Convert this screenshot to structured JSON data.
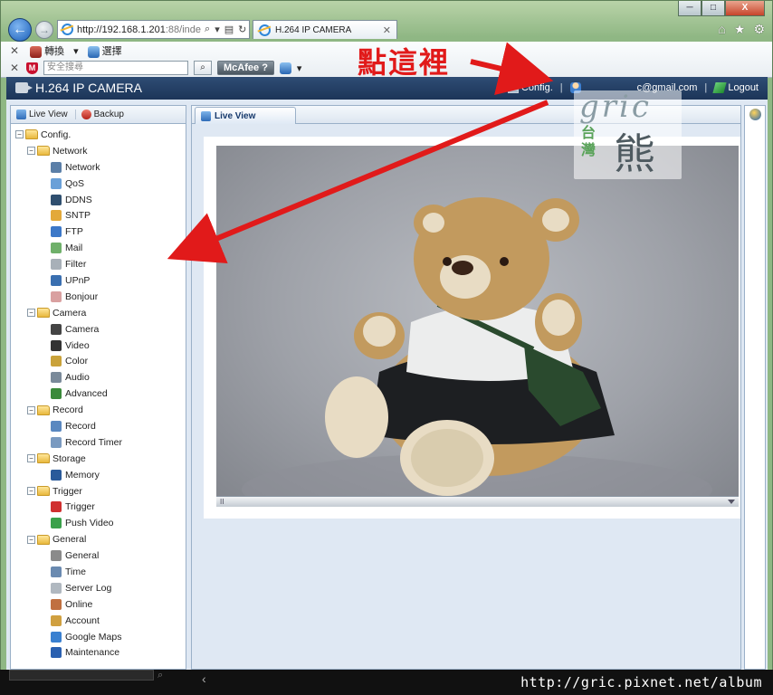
{
  "browser": {
    "window_buttons": [
      "─",
      "□",
      "X"
    ],
    "address": "http://192.168.1.201",
    "address_suffix": ":88/inde",
    "tab_title": "H.264 IP CAMERA",
    "toolbar_row1": [
      "轉換",
      "選擇"
    ],
    "search_placeholder": "安全搜尋",
    "mcafee_label": "McAfee"
  },
  "annotation": {
    "click_here": "點這裡",
    "arrow_color": "#e11a1a"
  },
  "app": {
    "title": "H.264 IP CAMERA",
    "header": {
      "config_label": "Config.",
      "email": "@gmail.com",
      "email_prefix": "c",
      "logout_label": "Logout"
    },
    "left_tabs": [
      "Live View",
      "Backup"
    ],
    "tree": [
      {
        "label": "Config.",
        "level": 0,
        "folder": true
      },
      {
        "label": "Network",
        "level": 1,
        "folder": true
      },
      {
        "label": "Network",
        "level": 2,
        "icon": "network-icon",
        "color": "#5b7fa8"
      },
      {
        "label": "QoS",
        "level": 2,
        "icon": "qos-icon",
        "color": "#6aa0d8"
      },
      {
        "label": "DDNS",
        "level": 2,
        "icon": "ddns-icon",
        "color": "#2f4f6f"
      },
      {
        "label": "SNTP",
        "level": 2,
        "icon": "sntp-icon",
        "color": "#e3a93a"
      },
      {
        "label": "FTP",
        "level": 2,
        "icon": "ftp-icon",
        "color": "#3c78c8"
      },
      {
        "label": "Mail",
        "level": 2,
        "icon": "mail-icon",
        "color": "#6fb06a"
      },
      {
        "label": "Filter",
        "level": 2,
        "icon": "filter-icon",
        "color": "#a8b0b8"
      },
      {
        "label": "UPnP",
        "level": 2,
        "icon": "upnp-icon",
        "color": "#3a6fb0"
      },
      {
        "label": "Bonjour",
        "level": 2,
        "icon": "bonjour-icon",
        "color": "#d9a0a0"
      },
      {
        "label": "Camera",
        "level": 1,
        "folder": true
      },
      {
        "label": "Camera",
        "level": 2,
        "icon": "camera-icon",
        "color": "#444444"
      },
      {
        "label": "Video",
        "level": 2,
        "icon": "video-icon",
        "color": "#333333"
      },
      {
        "label": "Color",
        "level": 2,
        "icon": "color-icon",
        "color": "#c9a23a"
      },
      {
        "label": "Audio",
        "level": 2,
        "icon": "audio-icon",
        "color": "#7a8a9a"
      },
      {
        "label": "Advanced",
        "level": 2,
        "icon": "advanced-icon",
        "color": "#3a8a3a"
      },
      {
        "label": "Record",
        "level": 1,
        "folder": true
      },
      {
        "label": "Record",
        "level": 2,
        "icon": "record-icon",
        "color": "#5a88c0"
      },
      {
        "label": "Record Timer",
        "level": 2,
        "icon": "record-timer-icon",
        "color": "#7a9ac0"
      },
      {
        "label": "Storage",
        "level": 1,
        "folder": true
      },
      {
        "label": "Memory",
        "level": 2,
        "icon": "memory-icon",
        "color": "#2a5a9a"
      },
      {
        "label": "Trigger",
        "level": 1,
        "folder": true
      },
      {
        "label": "Trigger",
        "level": 2,
        "icon": "trigger-icon",
        "color": "#d03030"
      },
      {
        "label": "Push Video",
        "level": 2,
        "icon": "push-video-icon",
        "color": "#3aa04a"
      },
      {
        "label": "General",
        "level": 1,
        "folder": true
      },
      {
        "label": "General",
        "level": 2,
        "icon": "general-icon",
        "color": "#8a8a8a"
      },
      {
        "label": "Time",
        "level": 2,
        "icon": "time-icon",
        "color": "#6a8ab0"
      },
      {
        "label": "Server Log",
        "level": 2,
        "icon": "server-log-icon",
        "color": "#b0b8c0"
      },
      {
        "label": "Online",
        "level": 2,
        "icon": "online-icon",
        "color": "#c07040"
      },
      {
        "label": "Account",
        "level": 2,
        "icon": "account-icon",
        "color": "#d0a040"
      },
      {
        "label": "Google Maps",
        "level": 2,
        "icon": "google-maps-icon",
        "color": "#3a80d0"
      },
      {
        "label": "Maintenance",
        "level": 2,
        "icon": "maintenance-icon",
        "color": "#2a60b0"
      }
    ],
    "main_tab": "Live View",
    "video_bar_label": "II"
  },
  "watermark": {
    "brand": "gric",
    "region_chars": "台灣",
    "big_char": "熊",
    "url": "http://gric.pixnet.net/album"
  }
}
